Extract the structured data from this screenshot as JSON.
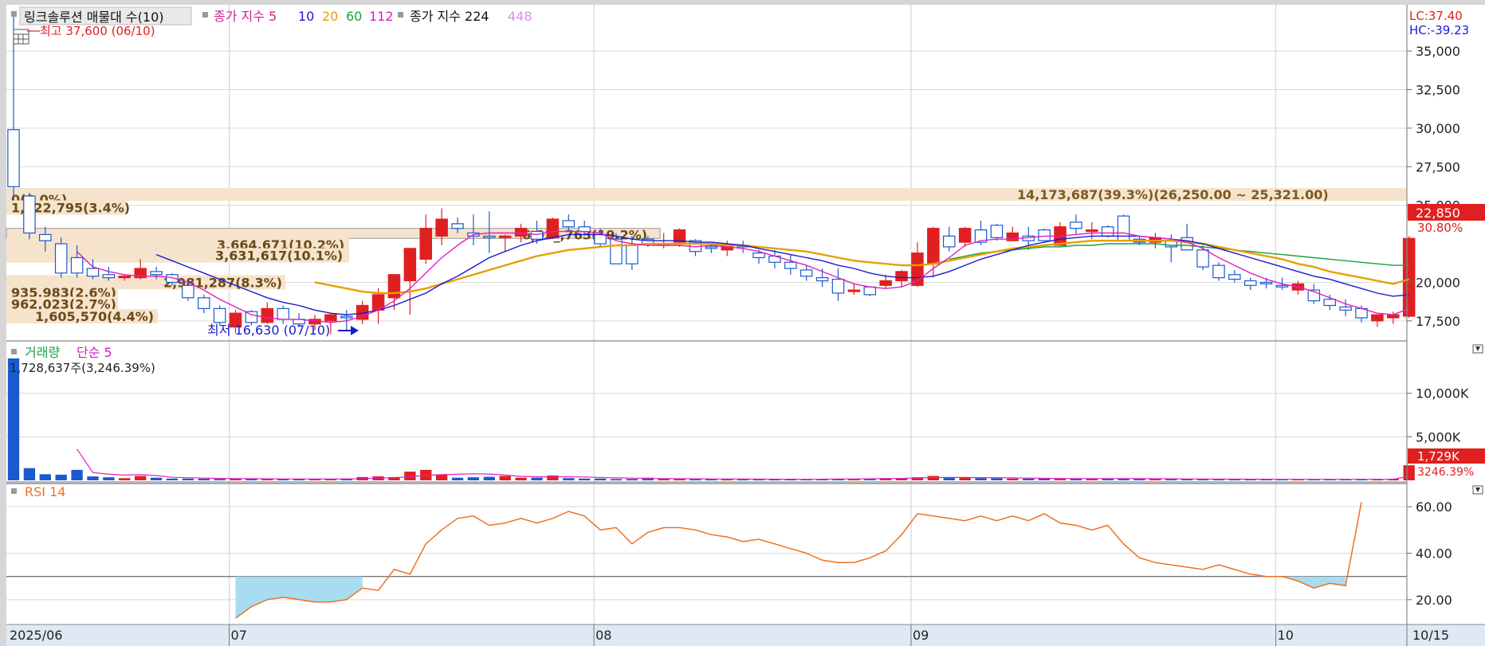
{
  "legend": {
    "title": "링크솔루션 매물대 수(10)",
    "ma_label": "종가 지수 5",
    "ma_periods": [
      "10",
      "20",
      "60",
      "112"
    ],
    "ma_colors": [
      "#1a1ad0",
      "#e6a000",
      "#18a040",
      "#d020c0"
    ],
    "ma2_label": "종가 지수 224",
    "ma2_period": "448",
    "ma2_period_color": "#d98ee8"
  },
  "price_axis": {
    "lc": "LC:37.40",
    "hc": "HC:-39.23",
    "ticks": [
      "35,000",
      "32,500",
      "30,000",
      "27,500",
      "25,000",
      "20,000",
      "17,500"
    ],
    "tick_values": [
      35000,
      32500,
      30000,
      27500,
      25000,
      20000,
      17500
    ],
    "current_price": "22,850",
    "current_change": "30.80%",
    "range": [
      16200,
      38000
    ]
  },
  "annotations": {
    "high": "최고 37,600 (06/10)",
    "low": "최저 16,630 (07/10)",
    "top_band": "14,173,687(39.3%)(26,250.00 ~ 25,321.00)",
    "bands": [
      {
        "label": "0(0.0%)",
        "price": 25400
      },
      {
        "label": "1,222,795(3.4%)",
        "price": 24850
      },
      {
        "label": "3,664,671(10.2%)",
        "price": 22450
      },
      {
        "label": "3,631,617(10.1%)",
        "price": 21750
      },
      {
        "label": "2,981,287(8.3%)",
        "price": 20000
      },
      {
        "label": "935,983(2.6%)",
        "price": 19350
      },
      {
        "label": "962,023(2.7%)",
        "price": 18600
      },
      {
        "label": "1,605,570(4.4%)",
        "price": 17800
      },
      {
        "label": "6,93_,763(19.2%)",
        "price": 23100
      }
    ]
  },
  "volume": {
    "label_a": "거래량",
    "label_b": "단순 5",
    "info": "1,728,637주(3,246.39%)",
    "ticks": [
      "10,000K",
      "5,000K"
    ],
    "tick_values": [
      10000,
      5000
    ],
    "current": "1,729K",
    "current_pct": "3246.39%",
    "max": 14000
  },
  "rsi": {
    "label": "RSI 14",
    "ticks": [
      "60.00",
      "40.00",
      "20.00"
    ],
    "tick_values": [
      60,
      40,
      20
    ],
    "range": [
      10,
      70
    ],
    "lines": [
      70,
      30
    ]
  },
  "time_axis": {
    "labels": [
      "2025/06",
      "07",
      "08",
      "09",
      "10",
      "10/15"
    ]
  },
  "chart_data": {
    "type": "candlestick",
    "n": 86,
    "month_starts": [
      {
        "label": "07",
        "index": 14
      },
      {
        "label": "08",
        "index": 37
      },
      {
        "label": "09",
        "index": 57
      },
      {
        "label": "10",
        "index": 80
      }
    ],
    "candles": [
      [
        29900,
        37600,
        25500,
        26200,
        14000
      ],
      [
        25600,
        25800,
        22800,
        23200,
        1400
      ],
      [
        23100,
        23600,
        22000,
        22700,
        700
      ],
      [
        22500,
        22900,
        20300,
        20600,
        650
      ],
      [
        21600,
        22400,
        20300,
        20600,
        1200
      ],
      [
        20900,
        21500,
        20200,
        20400,
        450
      ],
      [
        20500,
        21000,
        20100,
        20300,
        350
      ],
      [
        20300,
        20500,
        20100,
        20400,
        250
      ],
      [
        20300,
        21500,
        20200,
        20900,
        500
      ],
      [
        20700,
        21000,
        20200,
        20500,
        300
      ],
      [
        20500,
        20600,
        19800,
        20000,
        200
      ],
      [
        19800,
        20200,
        18800,
        19000,
        200
      ],
      [
        19000,
        19200,
        18000,
        18300,
        180
      ],
      [
        18300,
        18500,
        17200,
        17400,
        160
      ],
      [
        17100,
        18200,
        16700,
        18000,
        180
      ],
      [
        18100,
        18200,
        17200,
        17400,
        150
      ],
      [
        17400,
        18700,
        17300,
        18300,
        150
      ],
      [
        18300,
        18500,
        17300,
        17600,
        150
      ],
      [
        17600,
        18000,
        17100,
        17300,
        140
      ],
      [
        17300,
        17900,
        16900,
        17600,
        140
      ],
      [
        17500,
        18000,
        16630,
        17900,
        180
      ],
      [
        17800,
        18200,
        16800,
        17700,
        200
      ],
      [
        17600,
        18800,
        17300,
        18500,
        380
      ],
      [
        18200,
        19600,
        17300,
        19200,
        450
      ],
      [
        19000,
        20400,
        18200,
        20500,
        380
      ],
      [
        20100,
        20700,
        17900,
        22200,
        1000
      ],
      [
        21500,
        24400,
        21200,
        23500,
        1200
      ],
      [
        23000,
        24800,
        22400,
        24100,
        650
      ],
      [
        23800,
        24200,
        23200,
        23500,
        300
      ],
      [
        23200,
        24400,
        22400,
        23000,
        350
      ],
      [
        23000,
        24600,
        21900,
        22900,
        400
      ],
      [
        22900,
        23100,
        22000,
        23000,
        500
      ],
      [
        23000,
        23800,
        22600,
        23500,
        300
      ],
      [
        23300,
        24000,
        22500,
        22800,
        300
      ],
      [
        22900,
        24200,
        22800,
        24100,
        550
      ],
      [
        24000,
        24400,
        23300,
        23600,
        250
      ],
      [
        23600,
        24000,
        23000,
        23300,
        200
      ],
      [
        23100,
        23500,
        22300,
        22500,
        200
      ],
      [
        22800,
        23200,
        21500,
        21200,
        150
      ],
      [
        22400,
        23000,
        20800,
        21200,
        160
      ],
      [
        22800,
        23000,
        22300,
        22500,
        300
      ],
      [
        22400,
        23200,
        22200,
        22500,
        200
      ],
      [
        22600,
        23500,
        22300,
        23400,
        200
      ],
      [
        22700,
        22800,
        21700,
        22000,
        150
      ],
      [
        22300,
        22500,
        21900,
        22200,
        150
      ],
      [
        22100,
        22700,
        21700,
        22400,
        150
      ],
      [
        22400,
        22700,
        21900,
        22300,
        150
      ],
      [
        21900,
        22100,
        21200,
        21600,
        120
      ],
      [
        21700,
        22100,
        20900,
        21300,
        120
      ],
      [
        21300,
        21800,
        20500,
        20900,
        120
      ],
      [
        20800,
        21100,
        20100,
        20400,
        120
      ],
      [
        20300,
        20900,
        19700,
        20100,
        120
      ],
      [
        20200,
        20900,
        18800,
        19300,
        180
      ],
      [
        19400,
        19900,
        19200,
        19500,
        150
      ],
      [
        19700,
        19600,
        19100,
        19200,
        200
      ],
      [
        19800,
        20500,
        19600,
        20100,
        250
      ],
      [
        20100,
        20800,
        19700,
        20700,
        250
      ],
      [
        19800,
        22600,
        19700,
        21900,
        350
      ],
      [
        21200,
        23600,
        20300,
        23500,
        500
      ],
      [
        23000,
        23600,
        22000,
        22300,
        300
      ],
      [
        22600,
        23600,
        22300,
        23500,
        300
      ],
      [
        23400,
        24000,
        22400,
        22600,
        250
      ],
      [
        23700,
        23800,
        22700,
        22900,
        250
      ],
      [
        22700,
        23600,
        22700,
        23200,
        200
      ],
      [
        23000,
        23600,
        22100,
        22700,
        200
      ],
      [
        23400,
        23500,
        22700,
        22700,
        200
      ],
      [
        22400,
        23900,
        22500,
        23600,
        200
      ],
      [
        23900,
        24400,
        23100,
        23500,
        200
      ],
      [
        23300,
        23900,
        22800,
        23400,
        200
      ],
      [
        23600,
        23700,
        22900,
        23000,
        200
      ],
      [
        24300,
        24400,
        22800,
        22700,
        200
      ],
      [
        22800,
        23000,
        22400,
        22600,
        150
      ],
      [
        22600,
        23200,
        22200,
        22900,
        150
      ],
      [
        22700,
        23100,
        21300,
        22300,
        150
      ],
      [
        22900,
        23800,
        22100,
        22100,
        150
      ],
      [
        22100,
        22400,
        20800,
        21000,
        150
      ],
      [
        21100,
        21300,
        20100,
        20300,
        150
      ],
      [
        20500,
        20800,
        20000,
        20200,
        120
      ],
      [
        20100,
        20300,
        19500,
        19800,
        120
      ],
      [
        20000,
        20300,
        19600,
        19900,
        120
      ],
      [
        19800,
        20300,
        19500,
        19700,
        120
      ],
      [
        19500,
        20100,
        19200,
        19900,
        120
      ],
      [
        19500,
        19900,
        18600,
        18800,
        120
      ],
      [
        18900,
        19200,
        18200,
        18500,
        120
      ],
      [
        18400,
        18900,
        17800,
        18200,
        120
      ],
      [
        18300,
        18500,
        17400,
        17700,
        120
      ],
      [
        17500,
        17700,
        17100,
        17900,
        120
      ],
      [
        17700,
        18100,
        17300,
        17900,
        150
      ],
      [
        17800,
        23000,
        17700,
        22850,
        1729
      ]
    ],
    "ma5": [
      null,
      null,
      null,
      null,
      22000,
      21000,
      20700,
      20500,
      20400,
      20400,
      20300,
      20000,
      19500,
      18900,
      18400,
      17900,
      17700,
      17600,
      17600,
      17500,
      17400,
      17500,
      17800,
      18200,
      18800,
      19600,
      20600,
      21600,
      22400,
      23100,
      23200,
      23200,
      23200,
      23100,
      23300,
      23300,
      23300,
      23200,
      22700,
      22500,
      22400,
      22400,
      22400,
      22300,
      22400,
      22300,
      22200,
      22000,
      21700,
      21400,
      21100,
      20700,
      20300,
      19900,
      19700,
      19600,
      19700,
      20100,
      20900,
      21600,
      22400,
      22700,
      22800,
      22800,
      22900,
      23000,
      23000,
      23100,
      23200,
      23200,
      23200,
      23000,
      22900,
      22800,
      22600,
      22200,
      21600,
      21100,
      20600,
      20200,
      19900,
      19700,
      19400,
      19000,
      18600,
      18300,
      18000,
      17900,
      18300
    ],
    "ma10": [
      null,
      null,
      null,
      null,
      null,
      null,
      null,
      null,
      null,
      21800,
      21400,
      21000,
      20600,
      20200,
      19800,
      19400,
      19000,
      18700,
      18500,
      18200,
      18000,
      17900,
      18000,
      18200,
      18500,
      18900,
      19300,
      19900,
      20400,
      21000,
      21600,
      22000,
      22400,
      22700,
      22900,
      23100,
      23100,
      23100,
      23000,
      22800,
      22700,
      22700,
      22700,
      22600,
      22600,
      22500,
      22400,
      22200,
      22000,
      21800,
      21600,
      21400,
      21100,
      20900,
      20600,
      20400,
      20300,
      20300,
      20400,
      20700,
      21100,
      21500,
      21800,
      22100,
      22400,
      22600,
      22800,
      22900,
      23000,
      23000,
      23000,
      23000,
      22900,
      22800,
      22700,
      22500,
      22200,
      21900,
      21600,
      21300,
      21000,
      20700,
      20400,
      20200,
      19900,
      19600,
      19300,
      19100,
      19200
    ],
    "ma20": [
      null,
      null,
      null,
      null,
      null,
      null,
      null,
      null,
      null,
      null,
      null,
      null,
      null,
      null,
      null,
      null,
      null,
      null,
      null,
      20000,
      19800,
      19600,
      19400,
      19300,
      19300,
      19400,
      19600,
      19900,
      20200,
      20500,
      20800,
      21100,
      21400,
      21700,
      21900,
      22100,
      22200,
      22300,
      22400,
      22400,
      22500,
      22500,
      22500,
      22500,
      22500,
      22400,
      22400,
      22300,
      22200,
      22100,
      22000,
      21800,
      21600,
      21400,
      21300,
      21200,
      21100,
      21100,
      21200,
      21400,
      21600,
      21800,
      22000,
      22200,
      22300,
      22400,
      22500,
      22600,
      22700,
      22700,
      22700,
      22700,
      22700,
      22700,
      22600,
      22500,
      22300,
      22100,
      21900,
      21700,
      21500,
      21200,
      21000,
      20700,
      20500,
      20300,
      20100,
      19900,
      20200
    ],
    "ma60": [
      null,
      null,
      null,
      null,
      null,
      null,
      null,
      null,
      null,
      null,
      null,
      null,
      null,
      null,
      null,
      null,
      null,
      null,
      null,
      null,
      null,
      null,
      null,
      null,
      null,
      null,
      null,
      null,
      null,
      null,
      null,
      null,
      null,
      null,
      null,
      null,
      null,
      null,
      null,
      null,
      null,
      null,
      null,
      null,
      null,
      null,
      null,
      null,
      null,
      null,
      null,
      null,
      null,
      null,
      null,
      null,
      null,
      null,
      null,
      21500,
      21700,
      21900,
      22000,
      22100,
      22200,
      22300,
      22300,
      22400,
      22400,
      22500,
      22500,
      22500,
      22500,
      22400,
      22400,
      22300,
      22200,
      22100,
      22000,
      21900,
      21800,
      21700,
      21600,
      21500,
      21400,
      21300,
      21200,
      21100,
      21100
    ],
    "vol_ma5": [
      null,
      null,
      null,
      null,
      3600,
      900,
      700,
      600,
      650,
      550,
      350,
      300,
      260,
      220,
      200,
      180,
      170,
      160,
      155,
      150,
      150,
      160,
      200,
      250,
      300,
      420,
      560,
      650,
      700,
      750,
      720,
      600,
      450,
      400,
      400,
      400,
      380,
      320,
      280,
      260,
      210,
      190,
      180,
      170,
      160,
      150,
      150,
      140,
      130,
      125,
      120,
      130,
      150,
      160,
      170,
      190,
      220,
      270,
      320,
      330,
      330,
      310,
      300,
      280,
      260,
      230,
      210,
      200,
      200,
      200,
      200,
      190,
      180,
      170,
      160,
      150,
      140,
      140,
      130,
      125,
      120,
      120,
      120,
      120,
      120,
      120,
      120,
      125,
      450
    ],
    "rsi": [
      null,
      null,
      null,
      null,
      null,
      null,
      null,
      null,
      null,
      null,
      null,
      null,
      null,
      null,
      12,
      17,
      20,
      21,
      20,
      19,
      19,
      20,
      25,
      24,
      33,
      31,
      44,
      50,
      55,
      56,
      52,
      53,
      55,
      53,
      55,
      58,
      56,
      50,
      51,
      44,
      49,
      51,
      51,
      50,
      48,
      47,
      45,
      46,
      44,
      42,
      40,
      37,
      36,
      36,
      38,
      41,
      48,
      57,
      56,
      55,
      54,
      56,
      54,
      56,
      54,
      57,
      53,
      52,
      50,
      52,
      44,
      38,
      36,
      35,
      34,
      33,
      35,
      33,
      31,
      30,
      30,
      28,
      25,
      27,
      26,
      62
    ]
  }
}
